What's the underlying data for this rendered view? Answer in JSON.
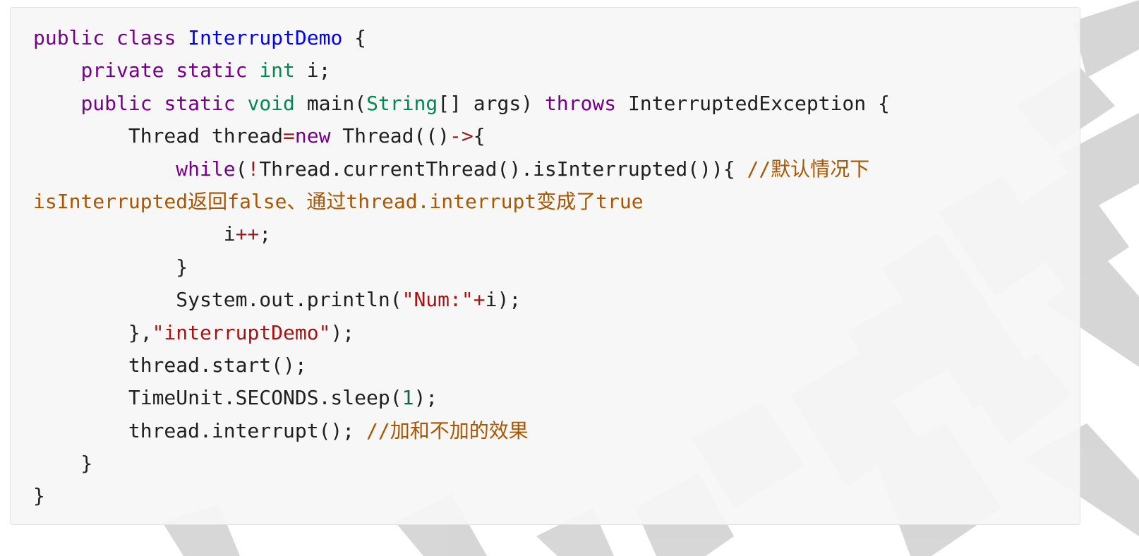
{
  "code_lines": [
    [
      {
        "t": "public",
        "c": "kw"
      },
      {
        "t": " "
      },
      {
        "t": "class",
        "c": "kw"
      },
      {
        "t": " "
      },
      {
        "t": "InterruptDemo",
        "c": "def"
      },
      {
        "t": " {"
      }
    ],
    [
      {
        "t": "    "
      },
      {
        "t": "private",
        "c": "kw"
      },
      {
        "t": " "
      },
      {
        "t": "static",
        "c": "kw"
      },
      {
        "t": " "
      },
      {
        "t": "int",
        "c": "ty"
      },
      {
        "t": " i;"
      }
    ],
    [
      {
        "t": "    "
      },
      {
        "t": "public",
        "c": "kw"
      },
      {
        "t": " "
      },
      {
        "t": "static",
        "c": "kw"
      },
      {
        "t": " "
      },
      {
        "t": "void",
        "c": "ty"
      },
      {
        "t": " main("
      },
      {
        "t": "String",
        "c": "ty"
      },
      {
        "t": "[] args) "
      },
      {
        "t": "throws",
        "c": "kw"
      },
      {
        "t": " InterruptedException {"
      }
    ],
    [
      {
        "t": "        Thread thread"
      },
      {
        "t": "=",
        "c": "op"
      },
      {
        "t": "new",
        "c": "kw"
      },
      {
        "t": " Thread(()"
      },
      {
        "t": "->",
        "c": "op"
      },
      {
        "t": "{"
      }
    ],
    [
      {
        "t": "            "
      },
      {
        "t": "while",
        "c": "kw"
      },
      {
        "t": "("
      },
      {
        "t": "!",
        "c": "op"
      },
      {
        "t": "Thread.currentThread().isInterrupted()){ "
      },
      {
        "t": "//默认情况下",
        "c": "cm"
      }
    ],
    [
      {
        "t": "isInterrupted返回false、通过thread.interrupt变成了true",
        "c": "cm"
      }
    ],
    [
      {
        "t": "                i"
      },
      {
        "t": "++",
        "c": "op"
      },
      {
        "t": ";"
      }
    ],
    [
      {
        "t": "            }"
      }
    ],
    [
      {
        "t": "            System.out.println("
      },
      {
        "t": "\"Num:\"",
        "c": "str"
      },
      {
        "t": "+",
        "c": "op"
      },
      {
        "t": "i);"
      }
    ],
    [
      {
        "t": "        },"
      },
      {
        "t": "\"interruptDemo\"",
        "c": "str"
      },
      {
        "t": ");"
      }
    ],
    [
      {
        "t": "        thread.start();"
      }
    ],
    [
      {
        "t": "        TimeUnit.SECONDS.sleep("
      },
      {
        "t": "1",
        "c": "num"
      },
      {
        "t": ");"
      }
    ],
    [
      {
        "t": "        thread.interrupt(); "
      },
      {
        "t": "//加和不加的效果",
        "c": "cm"
      }
    ],
    [
      {
        "t": "    }"
      }
    ],
    [
      {
        "t": "}"
      }
    ]
  ]
}
